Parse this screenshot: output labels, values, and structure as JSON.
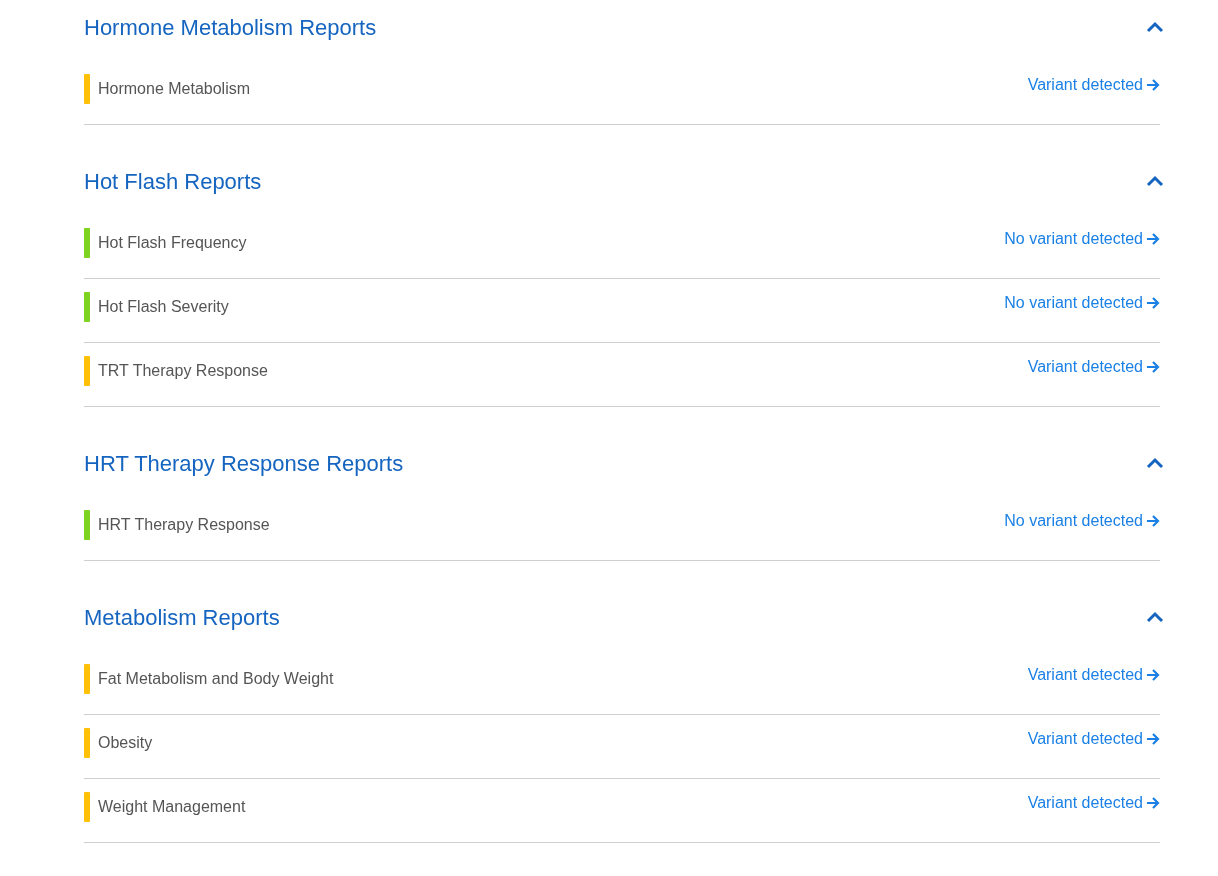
{
  "sections": [
    {
      "title": "Hormone Metabolism Reports",
      "expanded": true,
      "reports": [
        {
          "name": "Hormone Metabolism",
          "color": "#ffc107",
          "status": "Variant detected"
        }
      ]
    },
    {
      "title": "Hot Flash Reports",
      "expanded": true,
      "reports": [
        {
          "name": "Hot Flash Frequency",
          "color": "#7ed321",
          "status": "No variant detected"
        },
        {
          "name": "Hot Flash Severity",
          "color": "#7ed321",
          "status": "No variant detected"
        },
        {
          "name": "TRT Therapy Response",
          "color": "#ffc107",
          "status": "Variant detected"
        }
      ]
    },
    {
      "title": "HRT Therapy Response Reports",
      "expanded": true,
      "reports": [
        {
          "name": "HRT Therapy Response",
          "color": "#7ed321",
          "status": "No variant detected"
        }
      ]
    },
    {
      "title": "Metabolism Reports",
      "expanded": true,
      "reports": [
        {
          "name": "Fat Metabolism and Body Weight",
          "color": "#ffc107",
          "status": "Variant detected"
        },
        {
          "name": "Obesity",
          "color": "#ffc107",
          "status": "Variant detected"
        },
        {
          "name": "Weight Management",
          "color": "#ffc107",
          "status": "Variant detected"
        }
      ]
    }
  ]
}
